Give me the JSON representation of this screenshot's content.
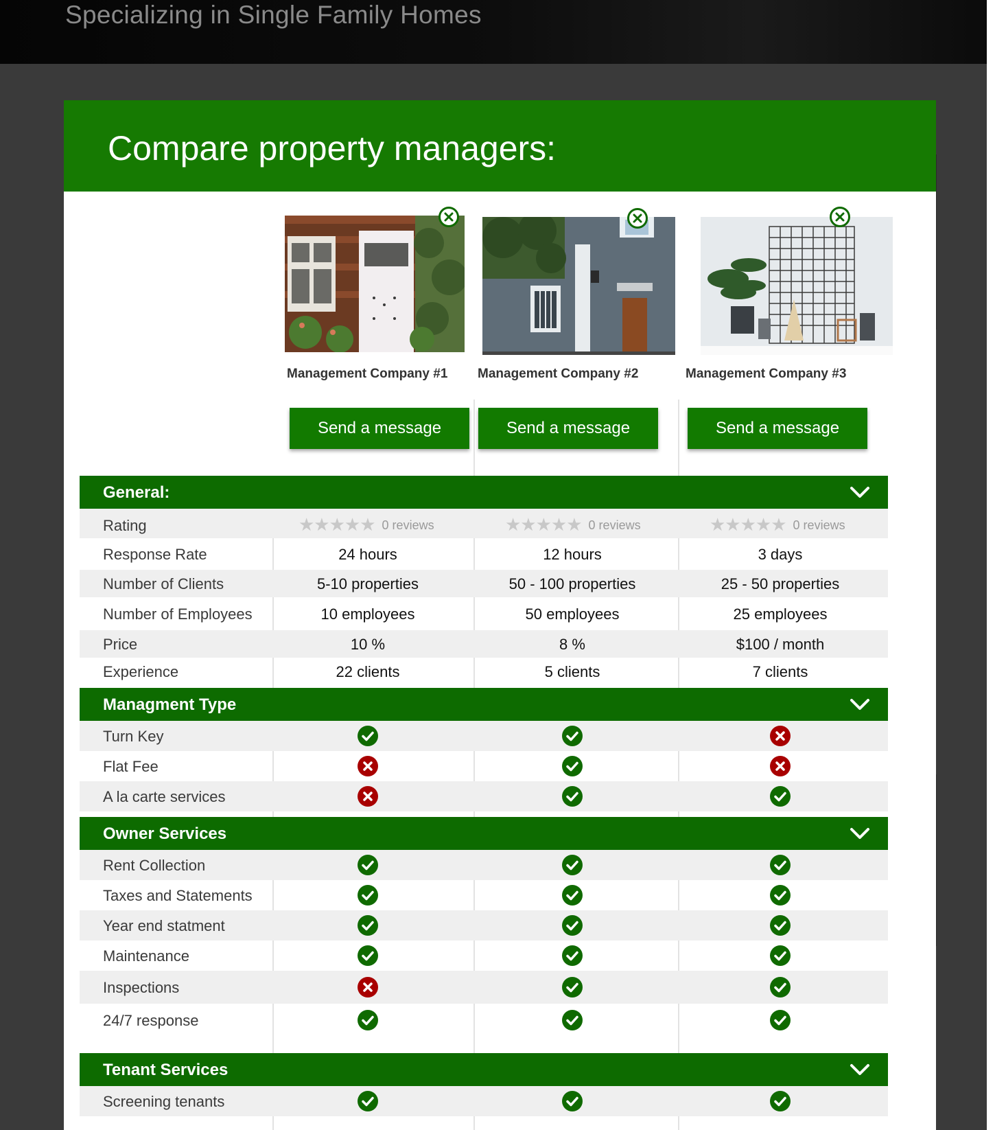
{
  "hero": {
    "subtitle": "Specializing in Single Family Homes"
  },
  "panel": {
    "title": "Compare property managers:"
  },
  "companies": [
    {
      "name": "Management Company #1",
      "button": "Send a message"
    },
    {
      "name": "Management Company #2",
      "button": "Send a message"
    },
    {
      "name": "Management Company #3",
      "button": "Send a message"
    }
  ],
  "sections": {
    "general": {
      "title": "General:",
      "rating": {
        "label": "Rating",
        "values": [
          "0 reviews",
          "0 reviews",
          "0 reviews"
        ],
        "stars_filled": [
          0,
          0,
          0
        ]
      },
      "rows": [
        {
          "label": "Response Rate",
          "values": [
            "24 hours",
            "12 hours",
            "3 days"
          ]
        },
        {
          "label": "Number of Clients",
          "values": [
            "5-10 properties",
            "50 - 100 properties",
            "25 - 50 properties"
          ]
        },
        {
          "label": "Number of Employees",
          "values": [
            "10 employees",
            "50 employees",
            "25 employees"
          ]
        },
        {
          "label": "Price",
          "values": [
            "10 %",
            "8 %",
            "$100  / month"
          ]
        },
        {
          "label": "Experience",
          "values": [
            "22 clients",
            "5 clients",
            "7 clients"
          ]
        }
      ]
    },
    "management_type": {
      "title": "Managment Type",
      "rows": [
        {
          "label": "Turn Key",
          "values": [
            true,
            true,
            false
          ]
        },
        {
          "label": "Flat Fee",
          "values": [
            false,
            true,
            false
          ]
        },
        {
          "label": "A la carte services",
          "values": [
            false,
            true,
            true
          ]
        }
      ]
    },
    "owner_services": {
      "title": "Owner Services",
      "rows": [
        {
          "label": "Rent Collection",
          "values": [
            true,
            true,
            true
          ]
        },
        {
          "label": "Taxes and Statements",
          "values": [
            true,
            true,
            true
          ]
        },
        {
          "label": "Year end statment",
          "values": [
            true,
            true,
            true
          ]
        },
        {
          "label": "Maintenance",
          "values": [
            true,
            true,
            true
          ]
        },
        {
          "label": "Inspections",
          "values": [
            false,
            true,
            true
          ]
        },
        {
          "label": "24/7 response",
          "values": [
            true,
            true,
            true
          ]
        }
      ]
    },
    "tenant_services": {
      "title": "Tenant Services",
      "rows": [
        {
          "label": "Screening tenants",
          "values": [
            true,
            true,
            true
          ]
        }
      ]
    }
  },
  "colors": {
    "brand_green": "#167a02",
    "section_green": "#0d6b00",
    "check_green": "#0f6a00",
    "cross_red": "#a80000"
  },
  "icons": {
    "check": "check-circle-icon",
    "cross": "x-circle-icon",
    "remove": "close-circle-icon",
    "collapse": "chevron-down-icon",
    "star": "star-icon"
  }
}
